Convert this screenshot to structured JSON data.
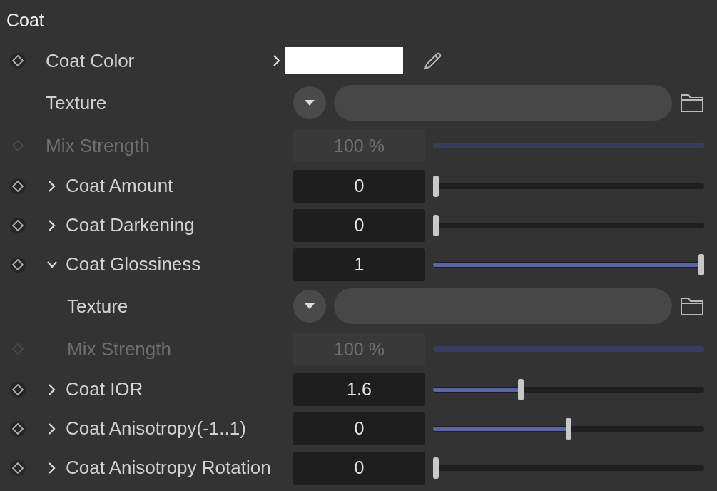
{
  "section_title": "Coat",
  "rows": [
    {
      "kind": "color",
      "label": "Coat Color",
      "expanded": false
    },
    {
      "kind": "texture",
      "label": "Texture"
    },
    {
      "kind": "mix",
      "label": "Mix Strength",
      "value": "100 %",
      "disabled": true,
      "level": 1
    },
    {
      "kind": "param",
      "label": "Coat Amount",
      "expanded": false,
      "value": "0",
      "level": 0
    },
    {
      "kind": "param",
      "label": "Coat Darkening",
      "expanded": false,
      "value": "0",
      "level": 0
    },
    {
      "kind": "param",
      "label": "Coat Glossiness",
      "expanded": true,
      "value": "1",
      "level": 1,
      "children": [
        {
          "kind": "texture",
          "label": "Texture"
        },
        {
          "kind": "mix",
          "label": "Mix Strength",
          "value": "100 %",
          "disabled": true,
          "level": 1
        }
      ]
    },
    {
      "kind": "param",
      "label": "Coat IOR",
      "expanded": false,
      "value": "1.6",
      "level": 0.32
    },
    {
      "kind": "param",
      "label": "Coat Anisotropy(-1..1)",
      "expanded": false,
      "value": "0",
      "level": 0.5
    },
    {
      "kind": "param",
      "label": "Coat Anisotropy Rotation",
      "expanded": false,
      "value": "0",
      "level": 0
    }
  ]
}
